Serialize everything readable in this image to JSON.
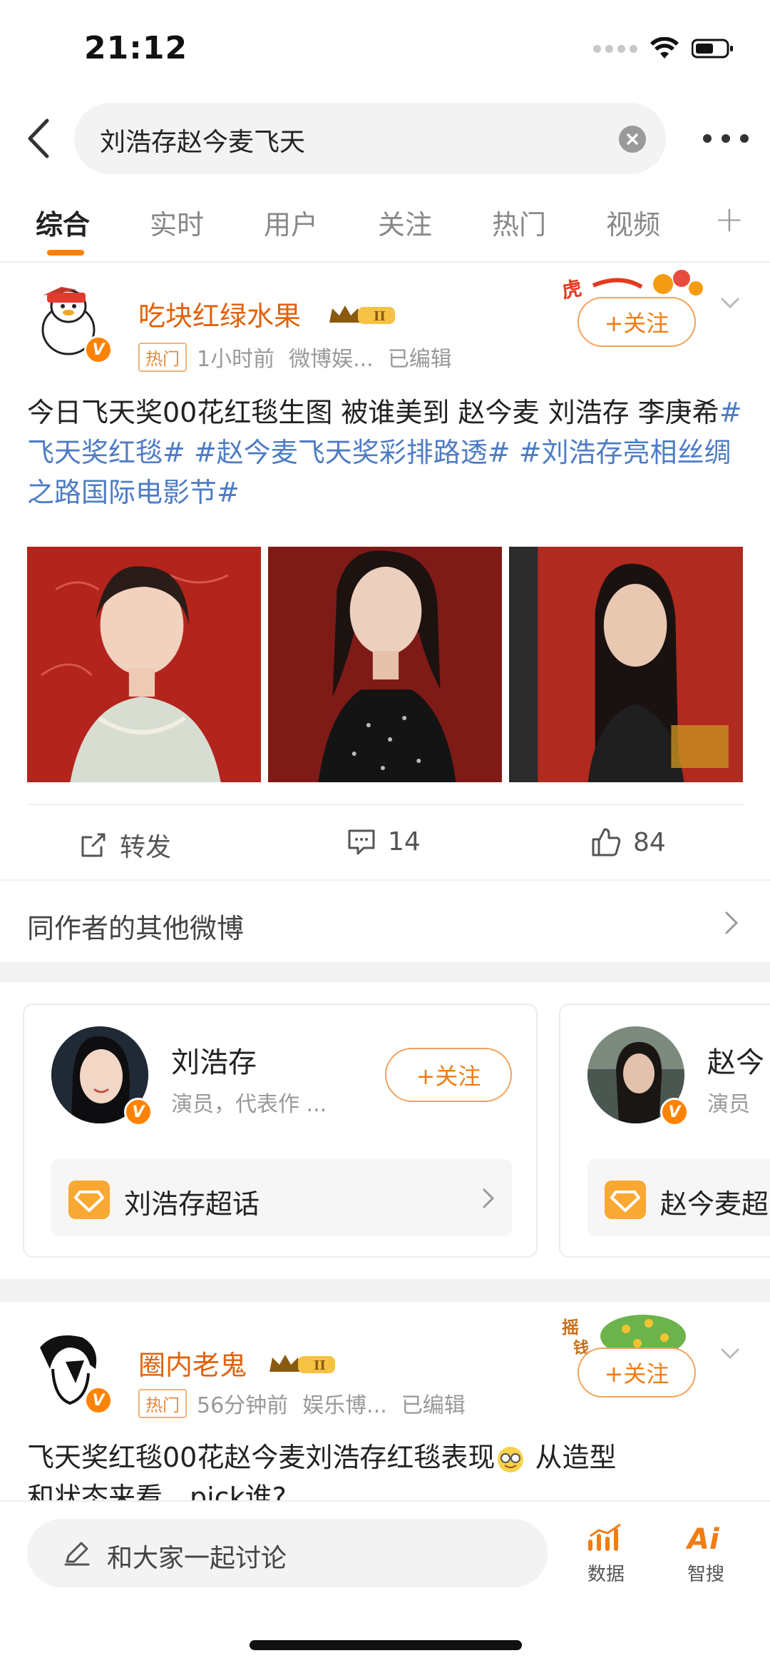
{
  "status": {
    "time": "21:12"
  },
  "search": {
    "query": "刘浩存赵今麦飞天"
  },
  "tabs": [
    "综合",
    "实时",
    "用户",
    "关注",
    "热门",
    "视频"
  ],
  "post1": {
    "username": "吃块红绿水果",
    "hot_tag": "热门",
    "time": "1小时前",
    "source": "微博娱...",
    "edited": "已编辑",
    "follow_label": "+关注",
    "text_plain": "今日飞天奖00花红毯生图 被谁美到  赵今麦 刘浩存 李庚希",
    "tags": [
      "#飞天奖红毯#",
      "#赵今麦飞天奖彩排路透#",
      "#刘浩存亮相丝绸之路国际电影节#"
    ],
    "repost_label": "转发",
    "comments": "14",
    "likes": "84"
  },
  "more_from_author": "同作者的其他微博",
  "cards": [
    {
      "name": "刘浩存",
      "desc": "演员，代表作 ...",
      "follow_label": "+关注",
      "super_topic": "刘浩存超话"
    },
    {
      "name": "赵今",
      "desc": "演员",
      "super_topic": "赵今麦超"
    }
  ],
  "post2": {
    "username": "圈内老鬼",
    "hot_tag": "热门",
    "time": "56分钟前",
    "source": "娱乐博...",
    "edited": "已编辑",
    "follow_label": "+关注",
    "text_line1": "飞天奖红毯00花赵今麦刘浩存红毯表现",
    "text_line1b": " 从造型",
    "text_line2": "和状态来看，pick谁?"
  },
  "bottom": {
    "discuss_placeholder": "和大家一起讨论",
    "data_label": "数据",
    "ai_label": "智搜"
  },
  "colors": {
    "accent": "#ff8200",
    "username": "#e0620c",
    "tag": "#4e7cc4"
  }
}
